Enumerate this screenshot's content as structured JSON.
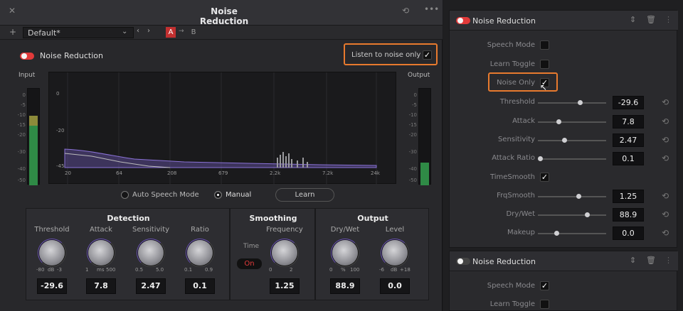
{
  "left": {
    "title": "Noise Reduction",
    "preset": "Default*",
    "ab": {
      "a": "A",
      "arrow": "→",
      "b": "B"
    },
    "enable_label": "Noise Reduction",
    "listen_label": "Listen to noise only",
    "input_label": "Input",
    "output_label": "Output",
    "meter_scale": [
      "0",
      "-5",
      "-10",
      "-15",
      "-20",
      "-30",
      "-40",
      "-50"
    ],
    "graph_y": [
      "0",
      "-20",
      "-45"
    ],
    "graph_x": [
      "20",
      "64",
      "208",
      "679",
      "2.2k",
      "7.2k",
      "24k"
    ],
    "auto_speech": "Auto Speech Mode",
    "manual": "Manual",
    "learn": "Learn",
    "detection": {
      "title": "Detection",
      "knobs": [
        {
          "label": "Threshold",
          "scale_min": "-80",
          "unit": "dB",
          "scale_max": "-3",
          "value": "-29.6"
        },
        {
          "label": "Attack",
          "scale_min": "1",
          "unit": "ms",
          "scale_max": "500",
          "value": "7.8"
        },
        {
          "label": "Sensitivity",
          "scale_min": "0.5",
          "unit": "",
          "scale_max": "5.0",
          "value": "2.47"
        },
        {
          "label": "Ratio",
          "scale_min": "0.1",
          "unit": "",
          "scale_max": "0.9",
          "value": "0.1"
        }
      ]
    },
    "smoothing": {
      "title": "Smoothing",
      "time_label": "Time",
      "time_toggle": "On",
      "knob": {
        "label": "Frequency",
        "scale_min": "0",
        "unit": "",
        "scale_max": "2",
        "value": "1.25"
      }
    },
    "output": {
      "title": "Output",
      "knobs": [
        {
          "label": "Dry/Wet",
          "scale_min": "0",
          "unit": "%",
          "scale_max": "100",
          "value": "88.9"
        },
        {
          "label": "Level",
          "scale_min": "-6",
          "unit": "dB",
          "scale_max": "+18",
          "value": "0.0"
        }
      ]
    }
  },
  "right": {
    "panel1": {
      "title": "Noise Reduction",
      "checks": [
        {
          "label": "Speech Mode",
          "checked": false
        },
        {
          "label": "Learn Toggle",
          "checked": false
        },
        {
          "label": "Noise Only",
          "checked": true
        }
      ],
      "sliders": [
        {
          "label": "Threshold",
          "value": "-29.6",
          "pos": 0.62
        },
        {
          "label": "Attack",
          "value": "7.8",
          "pos": 0.29
        },
        {
          "label": "Sensitivity",
          "value": "2.47",
          "pos": 0.38
        },
        {
          "label": "Attack Ratio",
          "value": "0.1",
          "pos": 0.0
        }
      ],
      "timesmooth": {
        "label": "TimeSmooth",
        "checked": true
      },
      "sliders2": [
        {
          "label": "FrqSmooth",
          "value": "1.25",
          "pos": 0.6
        },
        {
          "label": "Dry/Wet",
          "value": "88.9",
          "pos": 0.73
        },
        {
          "label": "Makeup",
          "value": "0.0",
          "pos": 0.25
        }
      ]
    },
    "panel2": {
      "title": "Noise Reduction",
      "checks": [
        {
          "label": "Speech Mode",
          "checked": true
        },
        {
          "label": "Learn Toggle",
          "checked": false
        }
      ]
    }
  },
  "colors": {
    "accent": "#e87a2e",
    "red": "#e23a3a",
    "purple": "#7b5fc0"
  }
}
